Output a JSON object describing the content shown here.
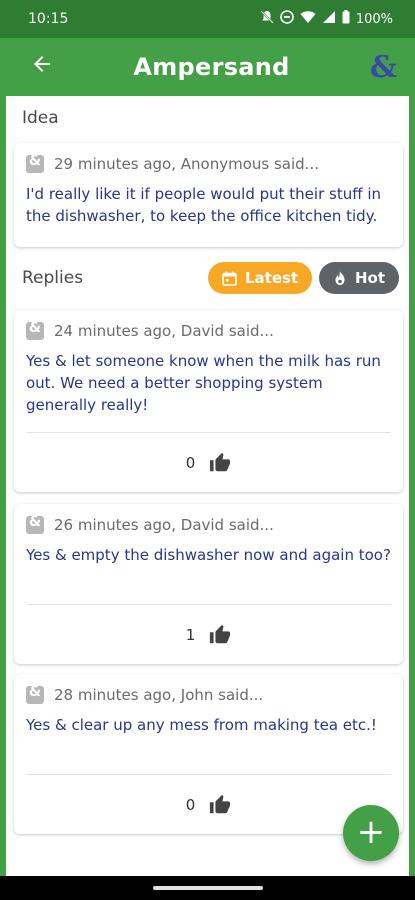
{
  "status_bar": {
    "time": "10:15",
    "battery": "100%"
  },
  "app_bar": {
    "title": "Ampersand",
    "back_icon": "arrow-left-icon",
    "logo_text": "&"
  },
  "idea": {
    "section_label": "Idea",
    "meta": "29 minutes ago, Anonymous said...",
    "text": "I'd really like it if people would put their stuff in the dishwasher, to keep the office kitchen tidy."
  },
  "replies": {
    "section_label": "Replies",
    "sort_latest": "Latest",
    "sort_hot": "Hot",
    "items": [
      {
        "meta": "24 minutes ago, David said...",
        "text": "Yes & let someone know when the milk has run out. We need a better shopping system generally really!",
        "likes": "0"
      },
      {
        "meta": "26 minutes ago, David said...",
        "text": "Yes & empty the dishwasher now and again too?",
        "likes": "1"
      },
      {
        "meta": "28 minutes ago, John said...",
        "text": "Yes & clear up any mess from making tea etc.!",
        "likes": "0"
      }
    ]
  },
  "fab": {
    "label": "+"
  },
  "colors": {
    "status_bar": "#2e7d32",
    "app_bar": "#43a047",
    "logo": "#3949ab",
    "body_text": "#283593",
    "latest_chip": "#f9a825",
    "hot_chip": "#5f6368"
  }
}
